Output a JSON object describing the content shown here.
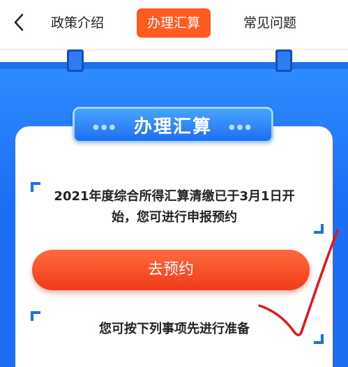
{
  "nav": {
    "tabs": [
      {
        "label": "政策介绍",
        "active": false
      },
      {
        "label": "办理汇算",
        "active": true
      },
      {
        "label": "常见问题",
        "active": false
      }
    ],
    "active_color": "#ff5a1f"
  },
  "panel": {
    "title": "办理汇算",
    "notice": "2021年度综合所得汇算清缴已于3月1日开始，您可进行申报预约",
    "button_label": "去预约",
    "prep_text": "您可按下列事项先进行准备"
  }
}
